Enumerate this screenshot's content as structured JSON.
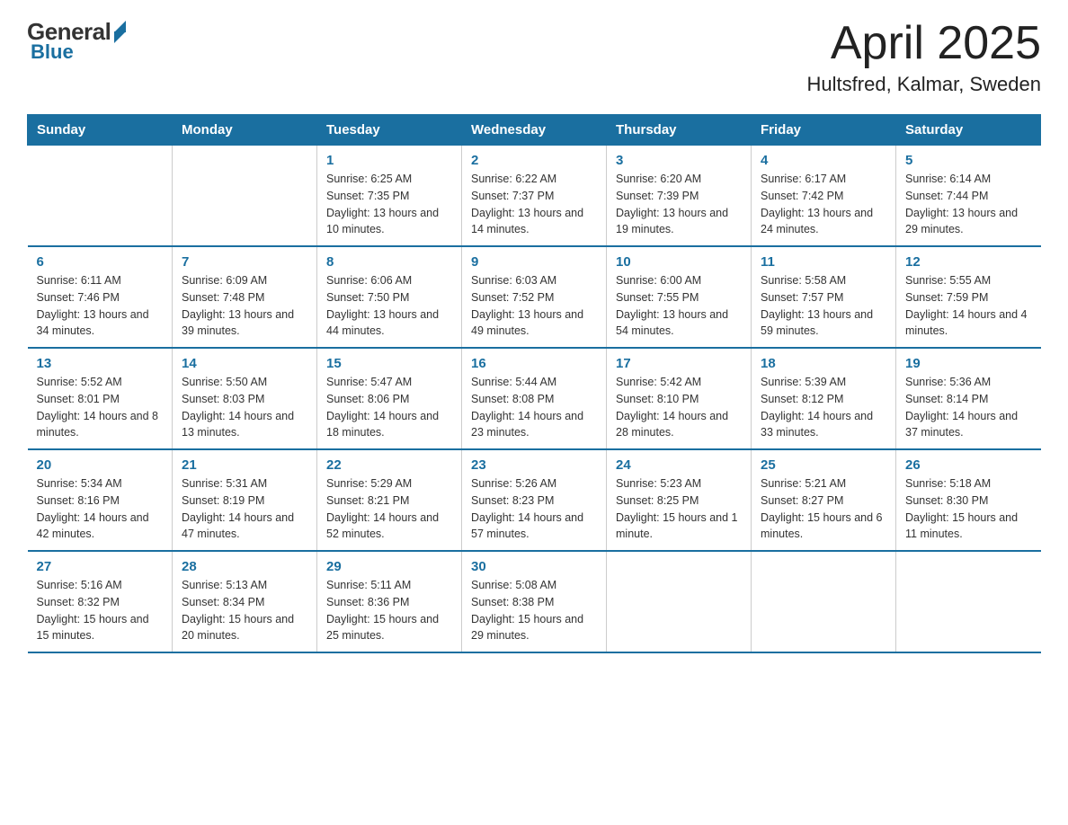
{
  "header": {
    "logo_general": "General",
    "logo_blue": "Blue",
    "month_title": "April 2025",
    "location": "Hultsfred, Kalmar, Sweden"
  },
  "days_of_week": [
    "Sunday",
    "Monday",
    "Tuesday",
    "Wednesday",
    "Thursday",
    "Friday",
    "Saturday"
  ],
  "weeks": [
    [
      null,
      null,
      {
        "day": "1",
        "sunrise": "Sunrise: 6:25 AM",
        "sunset": "Sunset: 7:35 PM",
        "daylight": "Daylight: 13 hours and 10 minutes."
      },
      {
        "day": "2",
        "sunrise": "Sunrise: 6:22 AM",
        "sunset": "Sunset: 7:37 PM",
        "daylight": "Daylight: 13 hours and 14 minutes."
      },
      {
        "day": "3",
        "sunrise": "Sunrise: 6:20 AM",
        "sunset": "Sunset: 7:39 PM",
        "daylight": "Daylight: 13 hours and 19 minutes."
      },
      {
        "day": "4",
        "sunrise": "Sunrise: 6:17 AM",
        "sunset": "Sunset: 7:42 PM",
        "daylight": "Daylight: 13 hours and 24 minutes."
      },
      {
        "day": "5",
        "sunrise": "Sunrise: 6:14 AM",
        "sunset": "Sunset: 7:44 PM",
        "daylight": "Daylight: 13 hours and 29 minutes."
      }
    ],
    [
      {
        "day": "6",
        "sunrise": "Sunrise: 6:11 AM",
        "sunset": "Sunset: 7:46 PM",
        "daylight": "Daylight: 13 hours and 34 minutes."
      },
      {
        "day": "7",
        "sunrise": "Sunrise: 6:09 AM",
        "sunset": "Sunset: 7:48 PM",
        "daylight": "Daylight: 13 hours and 39 minutes."
      },
      {
        "day": "8",
        "sunrise": "Sunrise: 6:06 AM",
        "sunset": "Sunset: 7:50 PM",
        "daylight": "Daylight: 13 hours and 44 minutes."
      },
      {
        "day": "9",
        "sunrise": "Sunrise: 6:03 AM",
        "sunset": "Sunset: 7:52 PM",
        "daylight": "Daylight: 13 hours and 49 minutes."
      },
      {
        "day": "10",
        "sunrise": "Sunrise: 6:00 AM",
        "sunset": "Sunset: 7:55 PM",
        "daylight": "Daylight: 13 hours and 54 minutes."
      },
      {
        "day": "11",
        "sunrise": "Sunrise: 5:58 AM",
        "sunset": "Sunset: 7:57 PM",
        "daylight": "Daylight: 13 hours and 59 minutes."
      },
      {
        "day": "12",
        "sunrise": "Sunrise: 5:55 AM",
        "sunset": "Sunset: 7:59 PM",
        "daylight": "Daylight: 14 hours and 4 minutes."
      }
    ],
    [
      {
        "day": "13",
        "sunrise": "Sunrise: 5:52 AM",
        "sunset": "Sunset: 8:01 PM",
        "daylight": "Daylight: 14 hours and 8 minutes."
      },
      {
        "day": "14",
        "sunrise": "Sunrise: 5:50 AM",
        "sunset": "Sunset: 8:03 PM",
        "daylight": "Daylight: 14 hours and 13 minutes."
      },
      {
        "day": "15",
        "sunrise": "Sunrise: 5:47 AM",
        "sunset": "Sunset: 8:06 PM",
        "daylight": "Daylight: 14 hours and 18 minutes."
      },
      {
        "day": "16",
        "sunrise": "Sunrise: 5:44 AM",
        "sunset": "Sunset: 8:08 PM",
        "daylight": "Daylight: 14 hours and 23 minutes."
      },
      {
        "day": "17",
        "sunrise": "Sunrise: 5:42 AM",
        "sunset": "Sunset: 8:10 PM",
        "daylight": "Daylight: 14 hours and 28 minutes."
      },
      {
        "day": "18",
        "sunrise": "Sunrise: 5:39 AM",
        "sunset": "Sunset: 8:12 PM",
        "daylight": "Daylight: 14 hours and 33 minutes."
      },
      {
        "day": "19",
        "sunrise": "Sunrise: 5:36 AM",
        "sunset": "Sunset: 8:14 PM",
        "daylight": "Daylight: 14 hours and 37 minutes."
      }
    ],
    [
      {
        "day": "20",
        "sunrise": "Sunrise: 5:34 AM",
        "sunset": "Sunset: 8:16 PM",
        "daylight": "Daylight: 14 hours and 42 minutes."
      },
      {
        "day": "21",
        "sunrise": "Sunrise: 5:31 AM",
        "sunset": "Sunset: 8:19 PM",
        "daylight": "Daylight: 14 hours and 47 minutes."
      },
      {
        "day": "22",
        "sunrise": "Sunrise: 5:29 AM",
        "sunset": "Sunset: 8:21 PM",
        "daylight": "Daylight: 14 hours and 52 minutes."
      },
      {
        "day": "23",
        "sunrise": "Sunrise: 5:26 AM",
        "sunset": "Sunset: 8:23 PM",
        "daylight": "Daylight: 14 hours and 57 minutes."
      },
      {
        "day": "24",
        "sunrise": "Sunrise: 5:23 AM",
        "sunset": "Sunset: 8:25 PM",
        "daylight": "Daylight: 15 hours and 1 minute."
      },
      {
        "day": "25",
        "sunrise": "Sunrise: 5:21 AM",
        "sunset": "Sunset: 8:27 PM",
        "daylight": "Daylight: 15 hours and 6 minutes."
      },
      {
        "day": "26",
        "sunrise": "Sunrise: 5:18 AM",
        "sunset": "Sunset: 8:30 PM",
        "daylight": "Daylight: 15 hours and 11 minutes."
      }
    ],
    [
      {
        "day": "27",
        "sunrise": "Sunrise: 5:16 AM",
        "sunset": "Sunset: 8:32 PM",
        "daylight": "Daylight: 15 hours and 15 minutes."
      },
      {
        "day": "28",
        "sunrise": "Sunrise: 5:13 AM",
        "sunset": "Sunset: 8:34 PM",
        "daylight": "Daylight: 15 hours and 20 minutes."
      },
      {
        "day": "29",
        "sunrise": "Sunrise: 5:11 AM",
        "sunset": "Sunset: 8:36 PM",
        "daylight": "Daylight: 15 hours and 25 minutes."
      },
      {
        "day": "30",
        "sunrise": "Sunrise: 5:08 AM",
        "sunset": "Sunset: 8:38 PM",
        "daylight": "Daylight: 15 hours and 29 minutes."
      },
      null,
      null,
      null
    ]
  ]
}
